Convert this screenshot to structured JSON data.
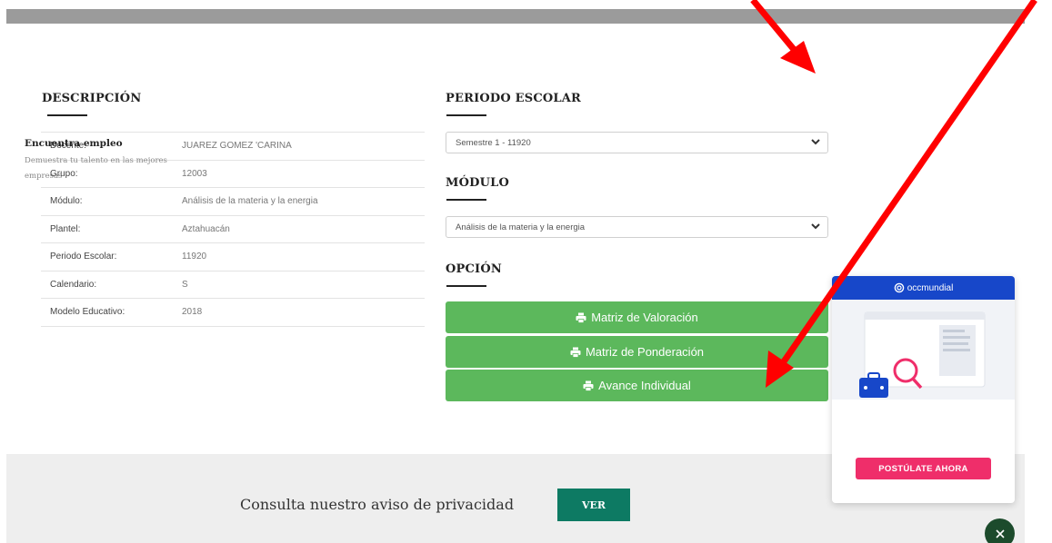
{
  "descripcion": {
    "title": "DESCRIPCIÓN",
    "rows": [
      {
        "key": "Docente:",
        "value": "JUAREZ GOMEZ 'CARINA"
      },
      {
        "key": "Grupo:",
        "value": "12003"
      },
      {
        "key": "Módulo:",
        "value": "Análisis de la materia y la energia"
      },
      {
        "key": "Plantel:",
        "value": "Aztahuacán"
      },
      {
        "key": "Periodo Escolar:",
        "value": "11920"
      },
      {
        "key": "Calendario:",
        "value": "S"
      },
      {
        "key": "Modelo Educativo:",
        "value": "2018"
      }
    ]
  },
  "periodo": {
    "title": "PERIODO ESCOLAR",
    "selected": "Semestre 1 - 11920"
  },
  "modulo": {
    "title": "MÓDULO",
    "selected": "Análisis de la materia y la energia"
  },
  "opcion": {
    "title": "OPCIÓN",
    "buttons": [
      {
        "label": "Matriz de Valoración"
      },
      {
        "label": "Matriz de Ponderación"
      },
      {
        "label": "Avance Individual"
      }
    ]
  },
  "footer": {
    "privacy_text": "Consulta nuestro aviso de privacidad",
    "ver_label": "VER"
  },
  "ad": {
    "brand": "occmundial",
    "title": "Encuentra empleo",
    "subtitle": "Demuestra tu talento en las mejores empresas",
    "cta": "POSTÚLATE AHORA",
    "close_icon": "close-icon"
  },
  "colors": {
    "green_button": "#5cb85c",
    "ver_button": "#0d7a63",
    "ad_header": "#1747c9",
    "ad_cta": "#ef2e6a",
    "annotation_arrow": "#ff0000"
  }
}
